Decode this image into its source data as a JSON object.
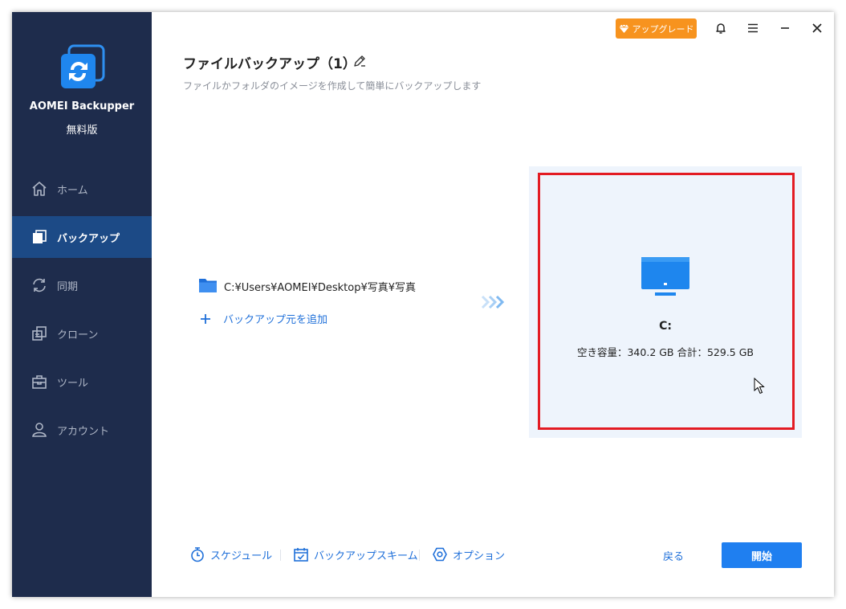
{
  "app": {
    "name": "AOMEI Backupper",
    "edition": "無料版"
  },
  "sidebar": {
    "items": [
      {
        "label": "ホーム",
        "icon": "home-icon",
        "active": false
      },
      {
        "label": "バックアップ",
        "icon": "backup-icon",
        "active": true
      },
      {
        "label": "同期",
        "icon": "sync-icon",
        "active": false
      },
      {
        "label": "クローン",
        "icon": "clone-icon",
        "active": false
      },
      {
        "label": "ツール",
        "icon": "toolbox-icon",
        "active": false
      },
      {
        "label": "アカウント",
        "icon": "user-icon",
        "active": false
      }
    ]
  },
  "titlebar": {
    "upgrade_label": "アップグレード"
  },
  "header": {
    "title": "ファイルバックアップ（1）",
    "subtitle": "ファイルかフォルダのイメージを作成して簡単にバックアップします"
  },
  "source": {
    "path": "C:¥Users¥AOMEI¥Desktop¥写真¥写真",
    "add_label": "バックアップ元を追加"
  },
  "destination": {
    "drive": "C:",
    "space": "空き容量：340.2 GB 合計：529.5 GB"
  },
  "toolbar": {
    "schedule_label": "スケジュール",
    "scheme_label": "バックアップスキーム",
    "options_label": "オプション",
    "back_label": "戻る",
    "start_label": "開始"
  },
  "colors": {
    "sidebar_bg": "#1e2c4c",
    "sidebar_active": "#1c4a86",
    "accent": "#1e6fd9",
    "upgrade": "#f7931e",
    "highlight": "#e31b23"
  }
}
